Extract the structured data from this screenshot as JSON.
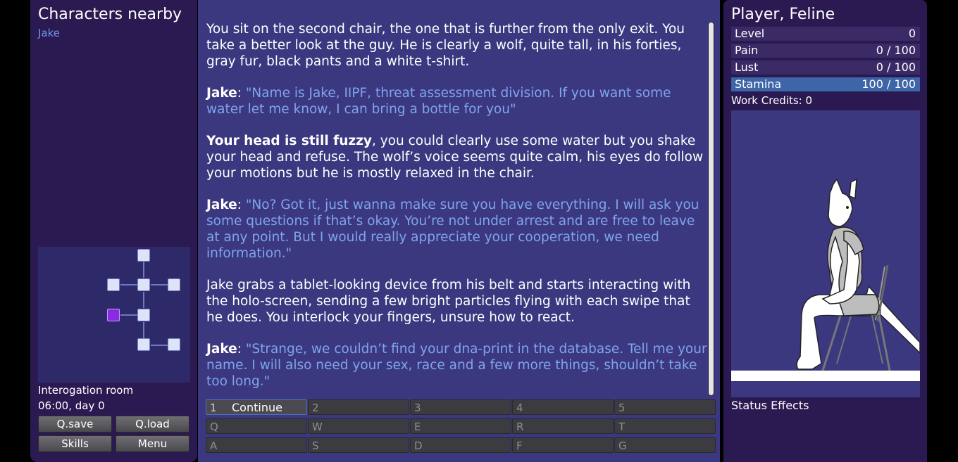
{
  "left": {
    "title": "Characters nearby",
    "characters": [
      "Jake"
    ],
    "location": "Interogation room",
    "time": "06:00, day 0",
    "buttons": {
      "qsave": "Q.save",
      "qload": "Q.load",
      "skills": "Skills",
      "menu": "Menu"
    }
  },
  "story": {
    "p1": "You sit on the second chair, the one that is further from the only exit. You take a better look at the guy. He is clearly a wolf, quite tall, in his forties, gray fur, black pants and a white t-shirt.",
    "p2_speaker": "Jake",
    "p2_quote": "\"Name is Jake, IIPF, threat assessment division. If you want some water let me know, I can bring a bottle for you\"",
    "p3_bold": "Your head is still fuzzy",
    "p3_rest": ", you could clearly use some water but you shake your head and refuse. The wolf’s voice seems quite calm, his eyes do follow your motions but he is mostly relaxed in the chair.",
    "p4_speaker": "Jake",
    "p4_quote": "\"No? Got it, just wanna make sure you have everything. I will ask you some questions if that’s okay. You’re not under arrest and are free to leave at any point. But I would really appreciate your cooperation, we need information.\"",
    "p5": "Jake grabs a tablet-looking device from his belt and starts interacting with the holo-screen, sending a few bright particles flying with each swipe that he does. You interlock your fingers, unsure how to react.",
    "p6_speaker": "Jake",
    "p6_quote": "\"Strange, we couldn’t find your dna-print in the database. Tell me your name. I will also need your sex, race and a few more things, shouldn’t take too long.\"",
    "colon": ": "
  },
  "actions": [
    {
      "key": "1",
      "label": "Continue"
    },
    {
      "key": "2",
      "label": ""
    },
    {
      "key": "3",
      "label": ""
    },
    {
      "key": "4",
      "label": ""
    },
    {
      "key": "5",
      "label": ""
    },
    {
      "key": "Q",
      "label": ""
    },
    {
      "key": "W",
      "label": ""
    },
    {
      "key": "E",
      "label": ""
    },
    {
      "key": "R",
      "label": ""
    },
    {
      "key": "T",
      "label": ""
    },
    {
      "key": "A",
      "label": ""
    },
    {
      "key": "S",
      "label": ""
    },
    {
      "key": "D",
      "label": ""
    },
    {
      "key": "F",
      "label": ""
    },
    {
      "key": "G",
      "label": ""
    }
  ],
  "player": {
    "title": "Player, Feline",
    "stats": [
      {
        "name": "Level",
        "value": "0"
      },
      {
        "name": "Pain",
        "value": "0 / 100"
      },
      {
        "name": "Lust",
        "value": "0 / 100"
      },
      {
        "name": "Stamina",
        "value": "100 / 100"
      }
    ],
    "credits": "Work Credits: 0",
    "status_effects": "Status Effects"
  },
  "colors": {
    "quote": "#7fa4ec",
    "stamina": "#3c66a8",
    "current_room": "#8a2be2"
  }
}
